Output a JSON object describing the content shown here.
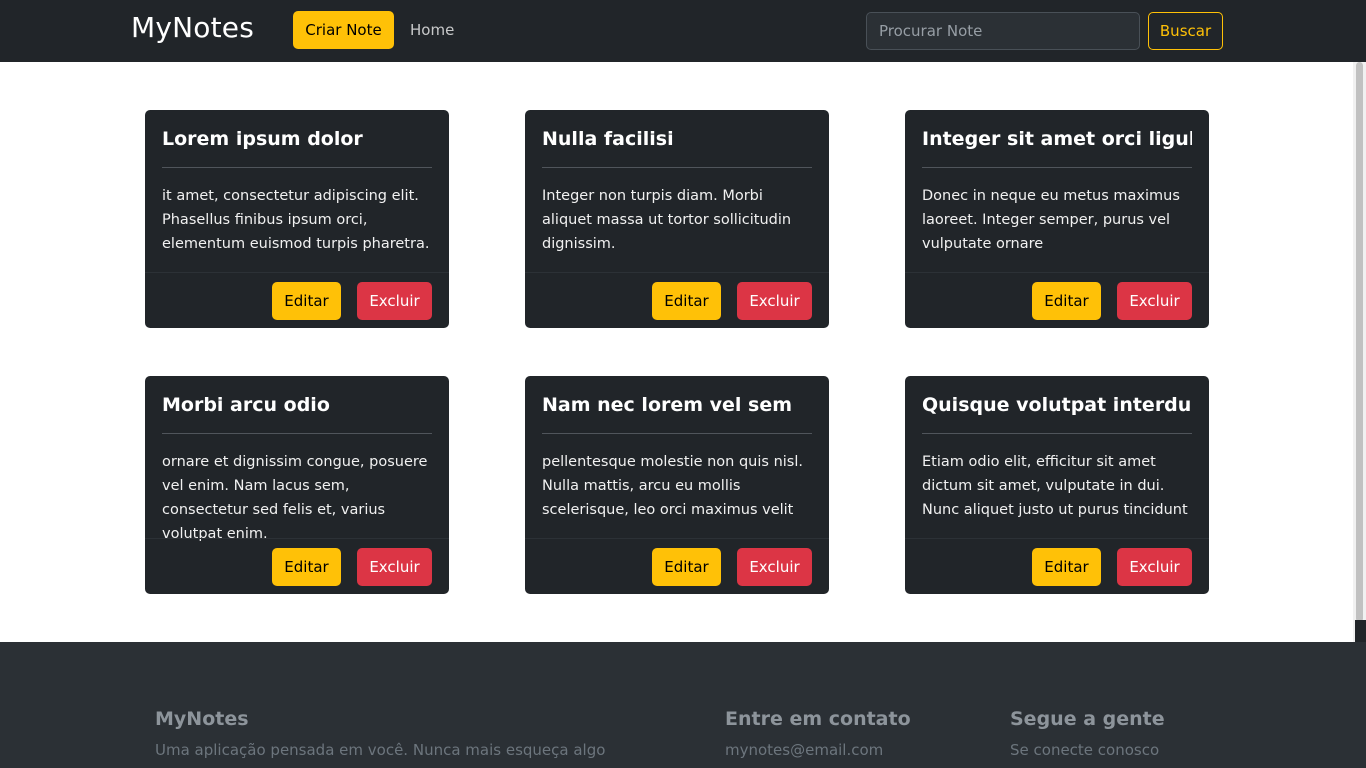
{
  "navbar": {
    "brand": "MyNotes",
    "create_label": "Criar Note",
    "home_label": "Home",
    "search_placeholder": "Procurar Note",
    "search_button": "Buscar"
  },
  "notes": [
    {
      "title": "Lorem ipsum dolor",
      "text": "it amet, consectetur adipiscing elit. Phasellus finibus ipsum orci, elementum euismod turpis pharetra.",
      "edit": "Editar",
      "delete": "Excluir"
    },
    {
      "title": "Nulla facilisi",
      "text": "Integer non turpis diam. Morbi aliquet massa ut tortor sollicitudin dignissim.",
      "edit": "Editar",
      "delete": "Excluir"
    },
    {
      "title": "Integer sit amet orci ligula",
      "text": "Donec in neque eu metus maximus laoreet. Integer semper, purus vel vulputate ornare",
      "edit": "Editar",
      "delete": "Excluir"
    },
    {
      "title": "Morbi arcu odio",
      "text": "ornare et dignissim congue, posuere vel enim. Nam lacus sem, consectetur sed felis et, varius volutpat enim.",
      "edit": "Editar",
      "delete": "Excluir"
    },
    {
      "title": "Nam nec lorem vel sem",
      "text": "pellentesque molestie non quis nisl. Nulla mattis, arcu eu mollis scelerisque, leo orci maximus velit",
      "edit": "Editar",
      "delete": "Excluir"
    },
    {
      "title": "Quisque volutpat interdum",
      "text": "Etiam odio elit, efficitur sit amet dictum sit amet, vulputate in dui. Nunc aliquet justo ut purus tincidunt",
      "edit": "Editar",
      "delete": "Excluir"
    }
  ],
  "footer": {
    "about_title": "MyNotes",
    "about_text": "Uma aplicação pensada em você. Nunca mais esqueça algo",
    "contact_title": "Entre em contato",
    "contact_email": "mynotes@email.com",
    "social_title": "Segue a gente",
    "social_text": "Se conecte conosco"
  },
  "colors": {
    "dark": "#212529",
    "warning": "#ffc107",
    "danger": "#dc3545"
  }
}
